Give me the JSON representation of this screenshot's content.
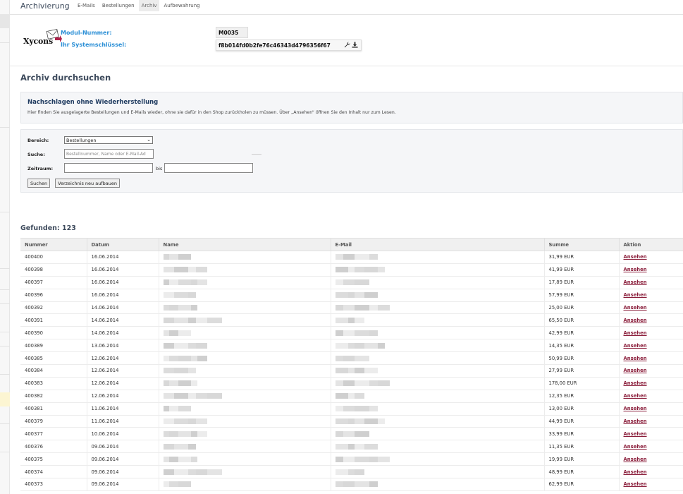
{
  "header": {
    "title": "Archivierung",
    "tabs": [
      {
        "label": "E-Mails",
        "active": false
      },
      {
        "label": "Bestellungen",
        "active": false
      },
      {
        "label": "Archiv",
        "active": true
      },
      {
        "label": "Aufbewahrung",
        "active": false
      }
    ]
  },
  "module": {
    "logo_text": "Xycons",
    "module_label": "Modul-Nummer:",
    "module_value": "M0035",
    "key_label": "Ihr Systemschlüssel:",
    "key_value": "f8b014fd0b2fe76c46343d4796356f67",
    "icons": [
      "wrench-icon",
      "download-icon"
    ]
  },
  "search_section": {
    "title": "Archiv durchsuchen"
  },
  "info": {
    "title": "Nachschlagen ohne Wiederherstellung",
    "text": "Hier finden Sie ausgelagerte Bestellungen und E-Mails wieder, ohne sie dafür in den Shop zurückholen zu müssen. Über „Ansehen“ öffnen Sie den Inhalt nur zum Lesen."
  },
  "form": {
    "area_label": "Bereich:",
    "area_value": "Bestellungen",
    "search_label": "Suche:",
    "search_placeholder": "Bestellnummer, Name oder E-Mail-Ad",
    "period_label": "Zeitraum:",
    "period_sep": "bis",
    "search_button": "Suchen",
    "rebuild_button": "Verzeichnis neu aufbauen"
  },
  "results": {
    "found_text": "Gefunden: 123",
    "columns": [
      "Nummer",
      "Datum",
      "Name",
      "E-Mail",
      "Summe",
      "Aktion"
    ],
    "action_label": "Ansehen",
    "rows": [
      {
        "nummer": "400400",
        "datum": "16.06.2014",
        "summe": "31,99 EUR"
      },
      {
        "nummer": "400398",
        "datum": "16.06.2014",
        "summe": "41,99 EUR"
      },
      {
        "nummer": "400397",
        "datum": "16.06.2014",
        "summe": "17,89 EUR"
      },
      {
        "nummer": "400396",
        "datum": "16.06.2014",
        "summe": "57,99 EUR"
      },
      {
        "nummer": "400392",
        "datum": "14.06.2014",
        "summe": "25,00 EUR"
      },
      {
        "nummer": "400391",
        "datum": "14.06.2014",
        "summe": "65,50 EUR"
      },
      {
        "nummer": "400390",
        "datum": "14.06.2014",
        "summe": "42,99 EUR"
      },
      {
        "nummer": "400389",
        "datum": "13.06.2014",
        "summe": "14,35 EUR"
      },
      {
        "nummer": "400385",
        "datum": "12.06.2014",
        "summe": "50,99 EUR"
      },
      {
        "nummer": "400384",
        "datum": "12.06.2014",
        "summe": "27,99 EUR"
      },
      {
        "nummer": "400383",
        "datum": "12.06.2014",
        "summe": "178,00 EUR"
      },
      {
        "nummer": "400382",
        "datum": "12.06.2014",
        "summe": "12,35 EUR"
      },
      {
        "nummer": "400381",
        "datum": "11.06.2014",
        "summe": "13,00 EUR"
      },
      {
        "nummer": "400379",
        "datum": "11.06.2014",
        "summe": "44,99 EUR"
      },
      {
        "nummer": "400377",
        "datum": "10.06.2014",
        "summe": "33,99 EUR"
      },
      {
        "nummer": "400376",
        "datum": "09.06.2014",
        "summe": "11,35 EUR"
      },
      {
        "nummer": "400375",
        "datum": "09.06.2014",
        "summe": "19,99 EUR"
      },
      {
        "nummer": "400374",
        "datum": "09.06.2014",
        "summe": "48,99 EUR"
      },
      {
        "nummer": "400373",
        "datum": "09.06.2014",
        "summe": "62,99 EUR"
      }
    ]
  },
  "colors": {
    "accent_blue": "#2b8fd6",
    "link": "#8a1d3a",
    "heading": "#3d4a5c",
    "info_title": "#1e3a5f"
  }
}
